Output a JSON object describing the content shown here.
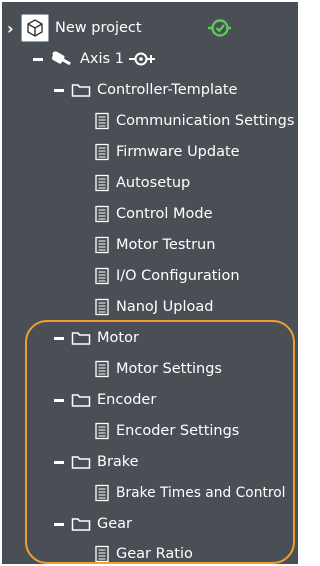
{
  "tree": {
    "project": {
      "label": "New project",
      "expand_glyph": "›",
      "status_icon": "check-circle-icon"
    },
    "axis": {
      "label": "Axis 1"
    },
    "controller": {
      "label": "Controller-Template",
      "items": [
        {
          "label": "Communication Settings"
        },
        {
          "label": "Firmware Update"
        },
        {
          "label": "Autosetup"
        },
        {
          "label": "Control Mode"
        },
        {
          "label": "Motor Testrun"
        },
        {
          "label": "I/O Configuration"
        },
        {
          "label": "NanoJ Upload"
        }
      ]
    },
    "motor": {
      "label": "Motor",
      "item": "Motor Settings"
    },
    "encoder": {
      "label": "Encoder",
      "item": "Encoder Settings"
    },
    "brake": {
      "label": "Brake",
      "item": "Brake Times and Control"
    },
    "gear": {
      "label": "Gear",
      "item": "Gear Ratio"
    }
  },
  "colors": {
    "panel_bg": "#4a4f55",
    "text": "#ffffff",
    "highlight": "#f0a030",
    "status_green": "#5cc85c"
  }
}
